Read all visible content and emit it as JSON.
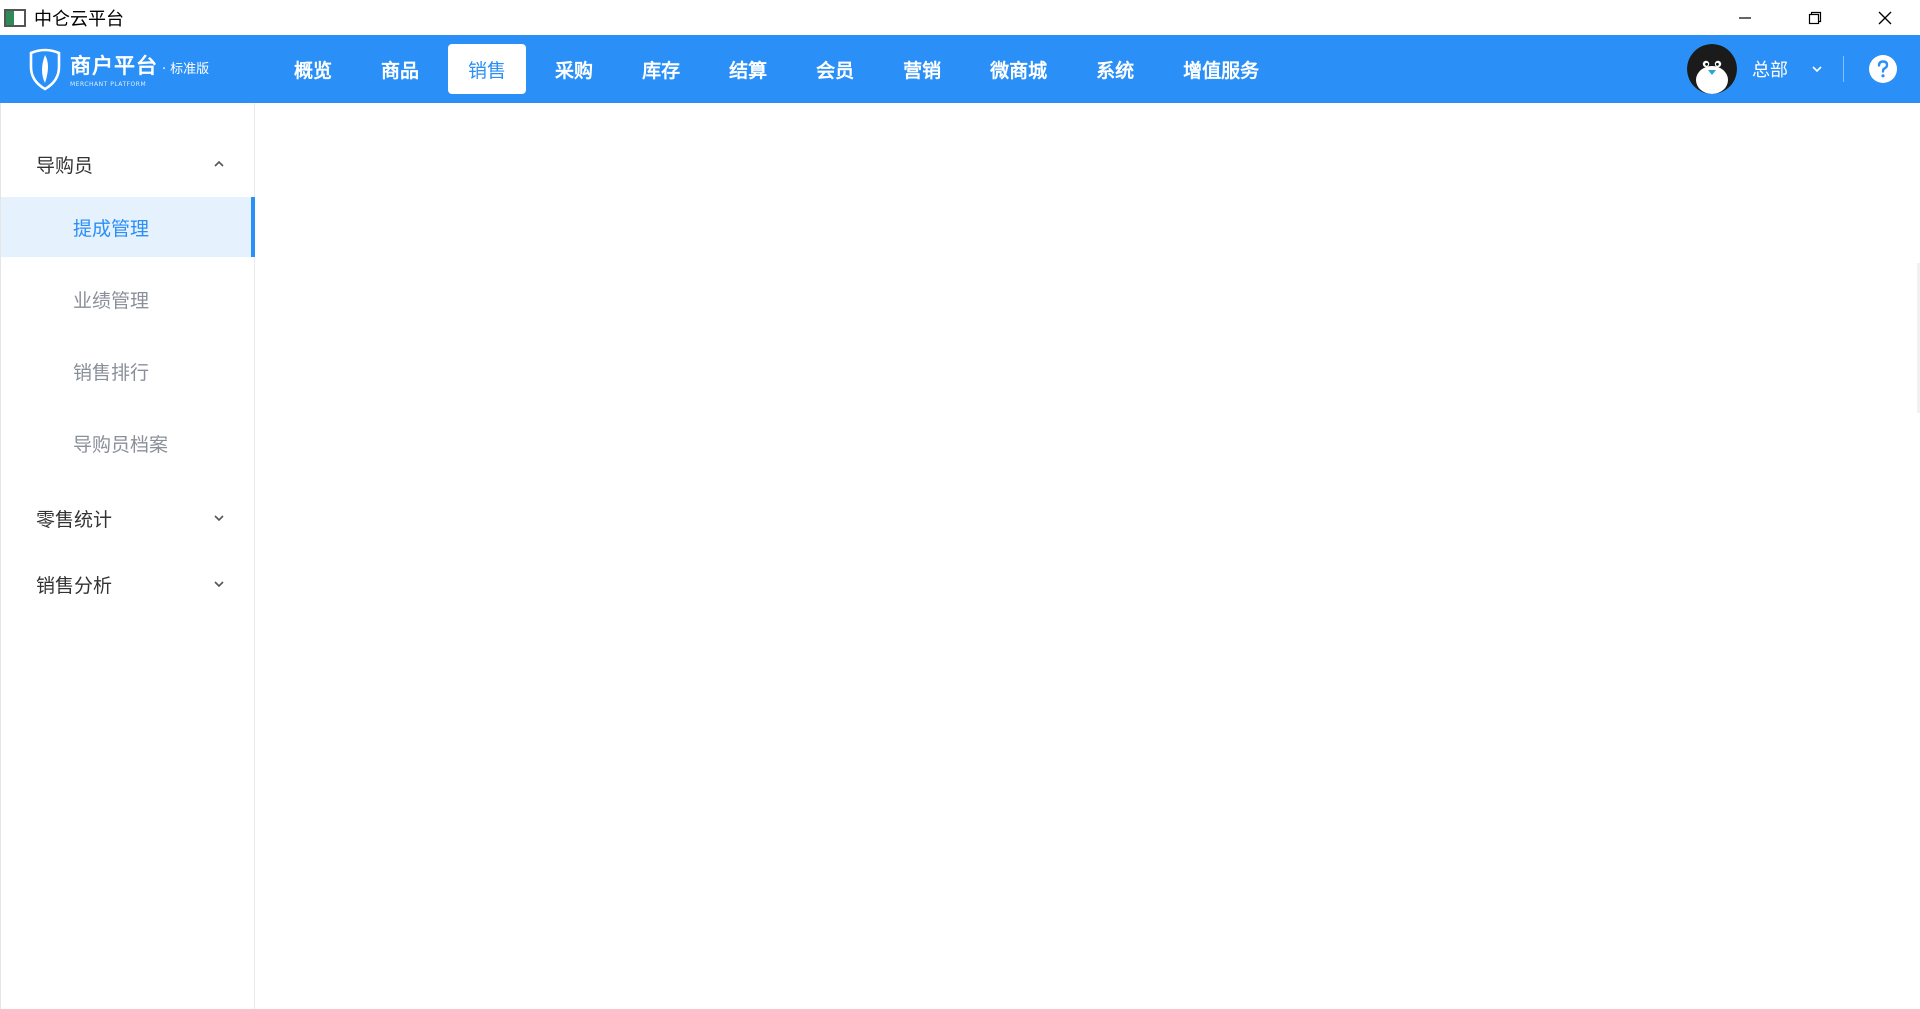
{
  "window": {
    "title": "中仑云平台",
    "controls": [
      "minimize-icon",
      "restore-icon",
      "close-icon"
    ]
  },
  "header": {
    "logo": {
      "title": "商户平台",
      "separator": "·",
      "edition": "标准版",
      "subtitle": "MERCHANT PLATFORM"
    },
    "nav": [
      {
        "label": "概览"
      },
      {
        "label": "商品"
      },
      {
        "label": "销售",
        "active": true
      },
      {
        "label": "采购"
      },
      {
        "label": "库存"
      },
      {
        "label": "结算"
      },
      {
        "label": "会员"
      },
      {
        "label": "营销"
      },
      {
        "label": "微商城"
      },
      {
        "label": "系统"
      },
      {
        "label": "增值服务"
      }
    ],
    "user": {
      "name": "总部",
      "icons": [
        "penguin-avatar",
        "chevron-down-icon",
        "help-icon"
      ]
    }
  },
  "sidebar": {
    "groups": [
      {
        "label": "导购员",
        "expanded": true,
        "items": [
          {
            "label": "提成管理",
            "active": true
          },
          {
            "label": "业绩管理"
          },
          {
            "label": "销售排行"
          },
          {
            "label": "导购员档案"
          }
        ]
      },
      {
        "label": "零售统计",
        "expanded": false
      },
      {
        "label": "销售分析",
        "expanded": false
      }
    ]
  },
  "colors": {
    "primary": "#2a8ff7",
    "active_bg": "#e6f1fe",
    "text_main": "#333333",
    "text_muted": "#8a8f99"
  }
}
